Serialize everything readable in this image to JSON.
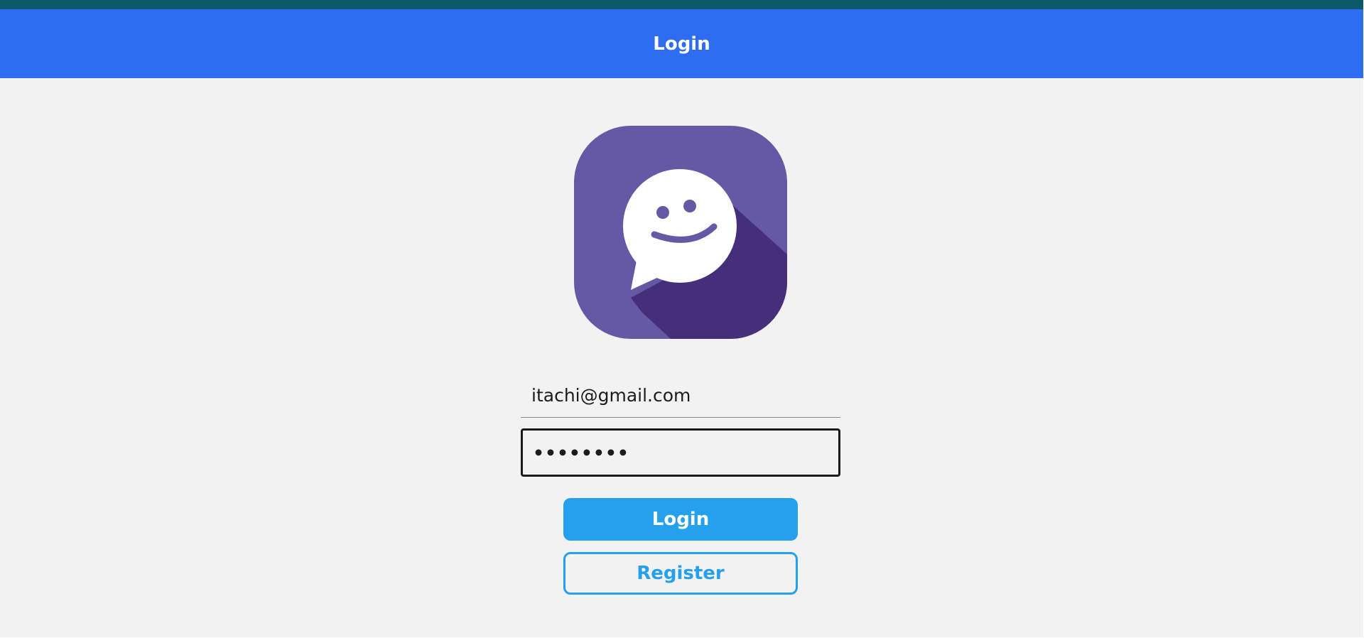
{
  "header": {
    "title": "Login"
  },
  "logo": {
    "icon": "smiley-chat-bubble-icon",
    "colors": {
      "background": "#6558a4",
      "shadow": "#452f7a",
      "foreground": "#ffffff"
    }
  },
  "form": {
    "email_value": "itachi@gmail.com",
    "password_value": "••••••••"
  },
  "buttons": {
    "login_label": "Login",
    "register_label": "Register"
  },
  "colors": {
    "header": "#2e6cf2",
    "top_strip": "#0a5a6a",
    "page_background": "#f2f2f2",
    "primary_button": "#25a0ec"
  }
}
